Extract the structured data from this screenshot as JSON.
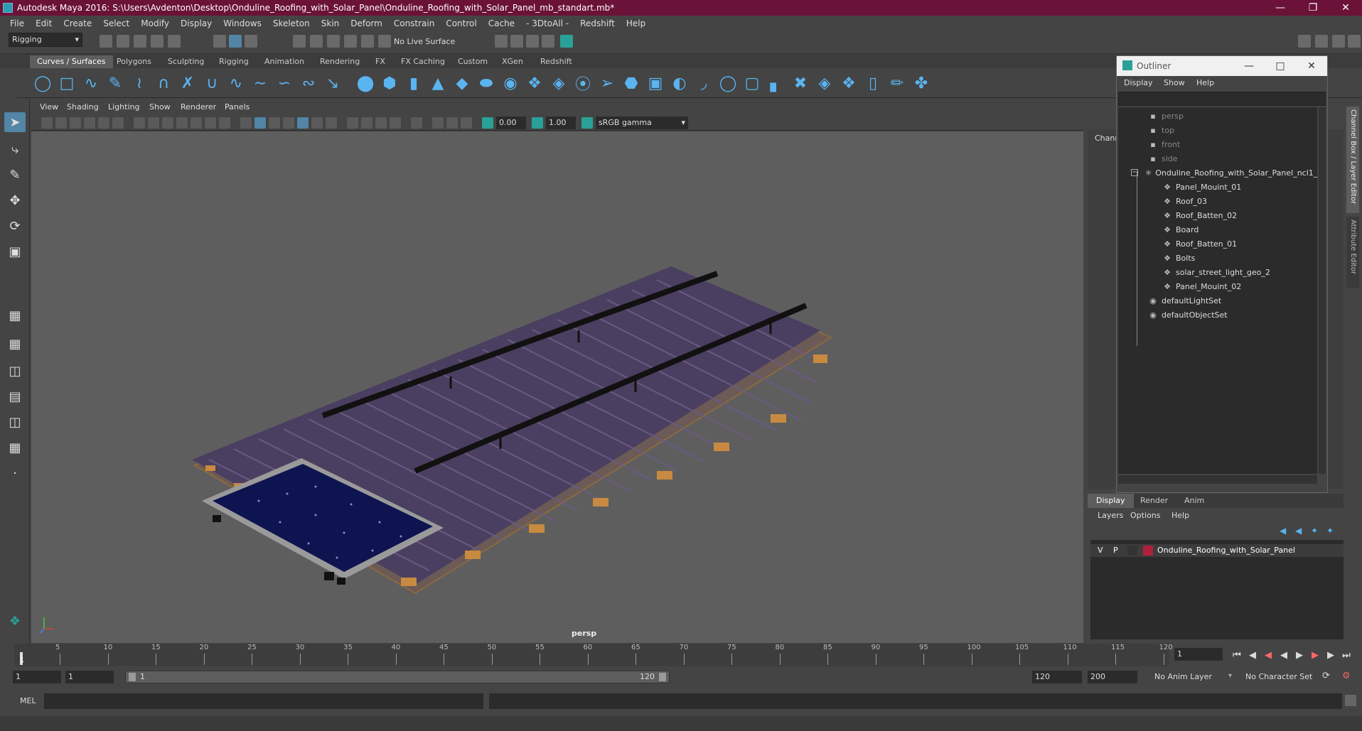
{
  "window": {
    "title": "Autodesk Maya 2016: S:\\Users\\Avdenton\\Desktop\\Onduline_Roofing_with_Solar_Panel\\Onduline_Roofing_with_Solar_Panel_mb_standart.mb*"
  },
  "menubar": [
    "File",
    "Edit",
    "Create",
    "Select",
    "Modify",
    "Display",
    "Windows",
    "Skeleton",
    "Skin",
    "Deform",
    "Constrain",
    "Control",
    "Cache",
    "- 3DtoAll -",
    "Redshift",
    "Help"
  ],
  "statusline": {
    "mode": "Rigging",
    "live_surface": "No Live Surface"
  },
  "shelf_tabs": [
    "Curves / Surfaces",
    "Polygons",
    "Sculpting",
    "Rigging",
    "Animation",
    "Rendering",
    "FX",
    "FX Caching",
    "Custom",
    "XGen",
    "Redshift"
  ],
  "shelf_active": "Curves / Surfaces",
  "viewport_menu": [
    "View",
    "Shading",
    "Lighting",
    "Show",
    "Renderer",
    "Panels"
  ],
  "viewport_toolbar": {
    "exposure": "0.00",
    "gamma": "1.00",
    "color_space": "sRGB gamma"
  },
  "viewport_label": "persp",
  "channel_box_label": "Chann",
  "outliner": {
    "title": "Outliner",
    "menu": [
      "Display",
      "Show",
      "Help"
    ],
    "items": [
      {
        "label": "persp",
        "icon": "camera-icon",
        "dim": true
      },
      {
        "label": "top",
        "icon": "camera-icon",
        "dim": true
      },
      {
        "label": "front",
        "icon": "camera-icon",
        "dim": true
      },
      {
        "label": "side",
        "icon": "camera-icon",
        "dim": true
      },
      {
        "label": "Onduline_Roofing_with_Solar_Panel_ncl1_",
        "icon": "group-icon",
        "dim": false
      },
      {
        "label": "Panel_Mouint_01",
        "icon": "mesh-icon",
        "dim": false
      },
      {
        "label": "Roof_03",
        "icon": "mesh-icon",
        "dim": false
      },
      {
        "label": "Roof_Batten_02",
        "icon": "mesh-icon",
        "dim": false
      },
      {
        "label": "Board",
        "icon": "mesh-icon",
        "dim": false
      },
      {
        "label": "Roof_Batten_01",
        "icon": "mesh-icon",
        "dim": false
      },
      {
        "label": "Bolts",
        "icon": "mesh-icon",
        "dim": false
      },
      {
        "label": "solar_street_light_geo_2",
        "icon": "mesh-icon",
        "dim": false
      },
      {
        "label": "Panel_Mouint_02",
        "icon": "mesh-icon",
        "dim": false
      },
      {
        "label": "defaultLightSet",
        "icon": "set-icon",
        "dim": false
      },
      {
        "label": "defaultObjectSet",
        "icon": "set-icon",
        "dim": false
      }
    ]
  },
  "side_tabs": {
    "channel": "Channel Box / Layer Editor",
    "attribute": "Attribute Editor"
  },
  "layer_tabs": [
    "Display",
    "Render",
    "Anim"
  ],
  "layer_menu": [
    "Layers",
    "Options",
    "Help"
  ],
  "layer": {
    "v": "V",
    "p": "P",
    "name": "Onduline_Roofing_with_Solar_Panel",
    "color": "#b0203a"
  },
  "timeline": {
    "ticks": [
      "5",
      "10",
      "15",
      "20",
      "25",
      "30",
      "35",
      "40",
      "45",
      "50",
      "55",
      "60",
      "65",
      "70",
      "75",
      "80",
      "85",
      "90",
      "95",
      "100",
      "105",
      "110",
      "115",
      "120"
    ],
    "current": "1",
    "current_frame_field": "1"
  },
  "range": {
    "start": "1",
    "playback_start": "1",
    "slider_start": "1",
    "slider_end": "120",
    "playback_end": "120",
    "end": "200",
    "anim_layer": "No Anim Layer",
    "character_set": "No Character Set"
  },
  "mel": {
    "label": "MEL"
  },
  "colors": {
    "accent": "#5285a6",
    "title_bar": "#6b1238",
    "shelf_icon": "#5ab4f0"
  }
}
